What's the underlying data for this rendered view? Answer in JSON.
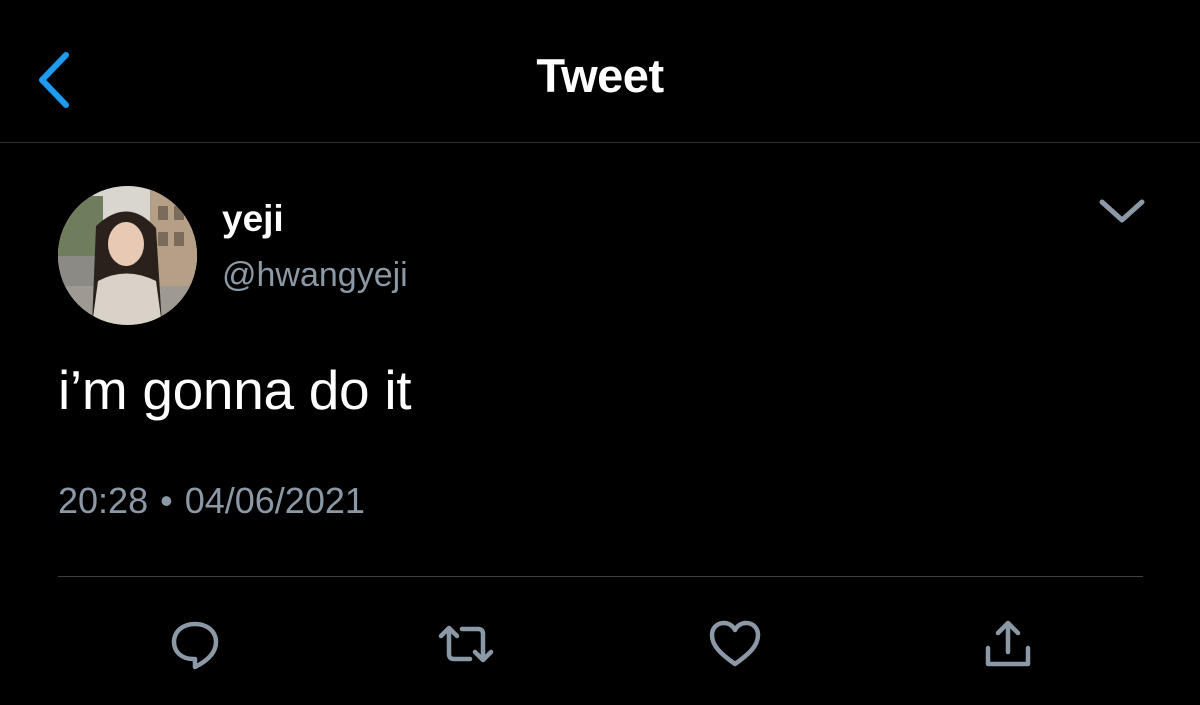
{
  "header": {
    "title": "Tweet",
    "back_icon": "chevron-left-icon",
    "accent_color": "#1d9bf0"
  },
  "tweet": {
    "author": {
      "display_name": "yeji",
      "handle": "@hwangyeji"
    },
    "text": "i’m gonna do it",
    "time": "20:28",
    "separator": "•",
    "date": "04/06/2021"
  },
  "actions": [
    {
      "name": "reply",
      "icon": "reply-icon"
    },
    {
      "name": "retweet",
      "icon": "retweet-icon"
    },
    {
      "name": "like",
      "icon": "heart-icon"
    },
    {
      "name": "share",
      "icon": "share-icon"
    }
  ],
  "colors": {
    "background": "#000000",
    "text_primary": "#ffffff",
    "text_secondary": "#8b98a5",
    "icon_gray": "#8b98a5"
  }
}
